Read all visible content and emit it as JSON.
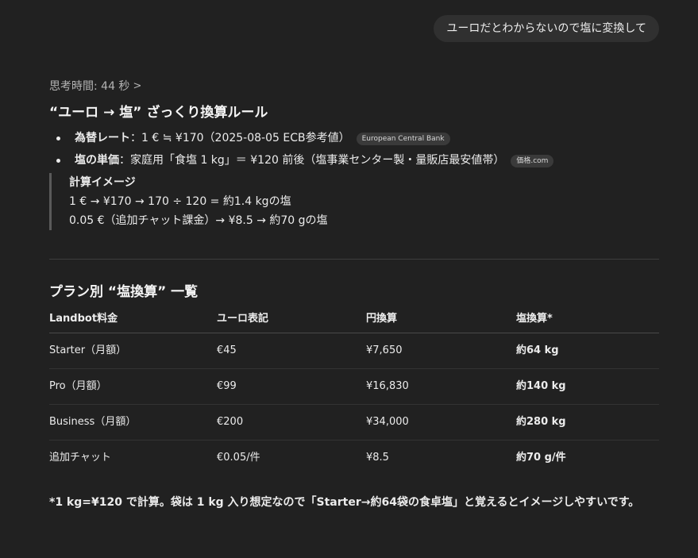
{
  "user_message": "ユーロだとわからないので塩に変換して",
  "thought": {
    "label": "思考時間: 44 秒",
    "chevron": ">"
  },
  "rules_heading": "“ユーロ → 塩” ざっくり換算ルール",
  "rules": [
    {
      "title": "為替レート",
      "text": "：1 € ≒ ¥170（2025-08-05 ECB参考値）",
      "source": "European Central Bank"
    },
    {
      "title": "塩の単価",
      "text": "：家庭用「食塩 1 kg」＝ ¥120 前後（塩事業センター製・量販店最安値帯）",
      "source": "価格.com"
    }
  ],
  "calc": {
    "title": "計算イメージ",
    "line1": "1 € → ¥170 → 170 ÷ 120 = 約1.4 kgの塩",
    "line2": "0.05 €（追加チャット課金）→ ¥8.5 → 約70 gの塩"
  },
  "table_heading": "プラン別 “塩換算” 一覧",
  "table": {
    "headers": [
      "Landbot料金",
      "ユーロ表記",
      "円換算",
      "塩換算*"
    ],
    "rows": [
      [
        "Starter（月額）",
        "€45",
        "¥7,650",
        "約64 kg"
      ],
      [
        "Pro（月額）",
        "€99",
        "¥16,830",
        "約140 kg"
      ],
      [
        "Business（月額）",
        "€200",
        "¥34,000",
        "約280 kg"
      ],
      [
        "追加チャット",
        "€0.05/件",
        "¥8.5",
        "約70 g/件"
      ]
    ]
  },
  "footnote": "*1 kg=¥120 で計算。袋は 1 kg 入り想定なので「Starter→約64袋の食卓塩」と覚えるとイメージしやすいです。"
}
